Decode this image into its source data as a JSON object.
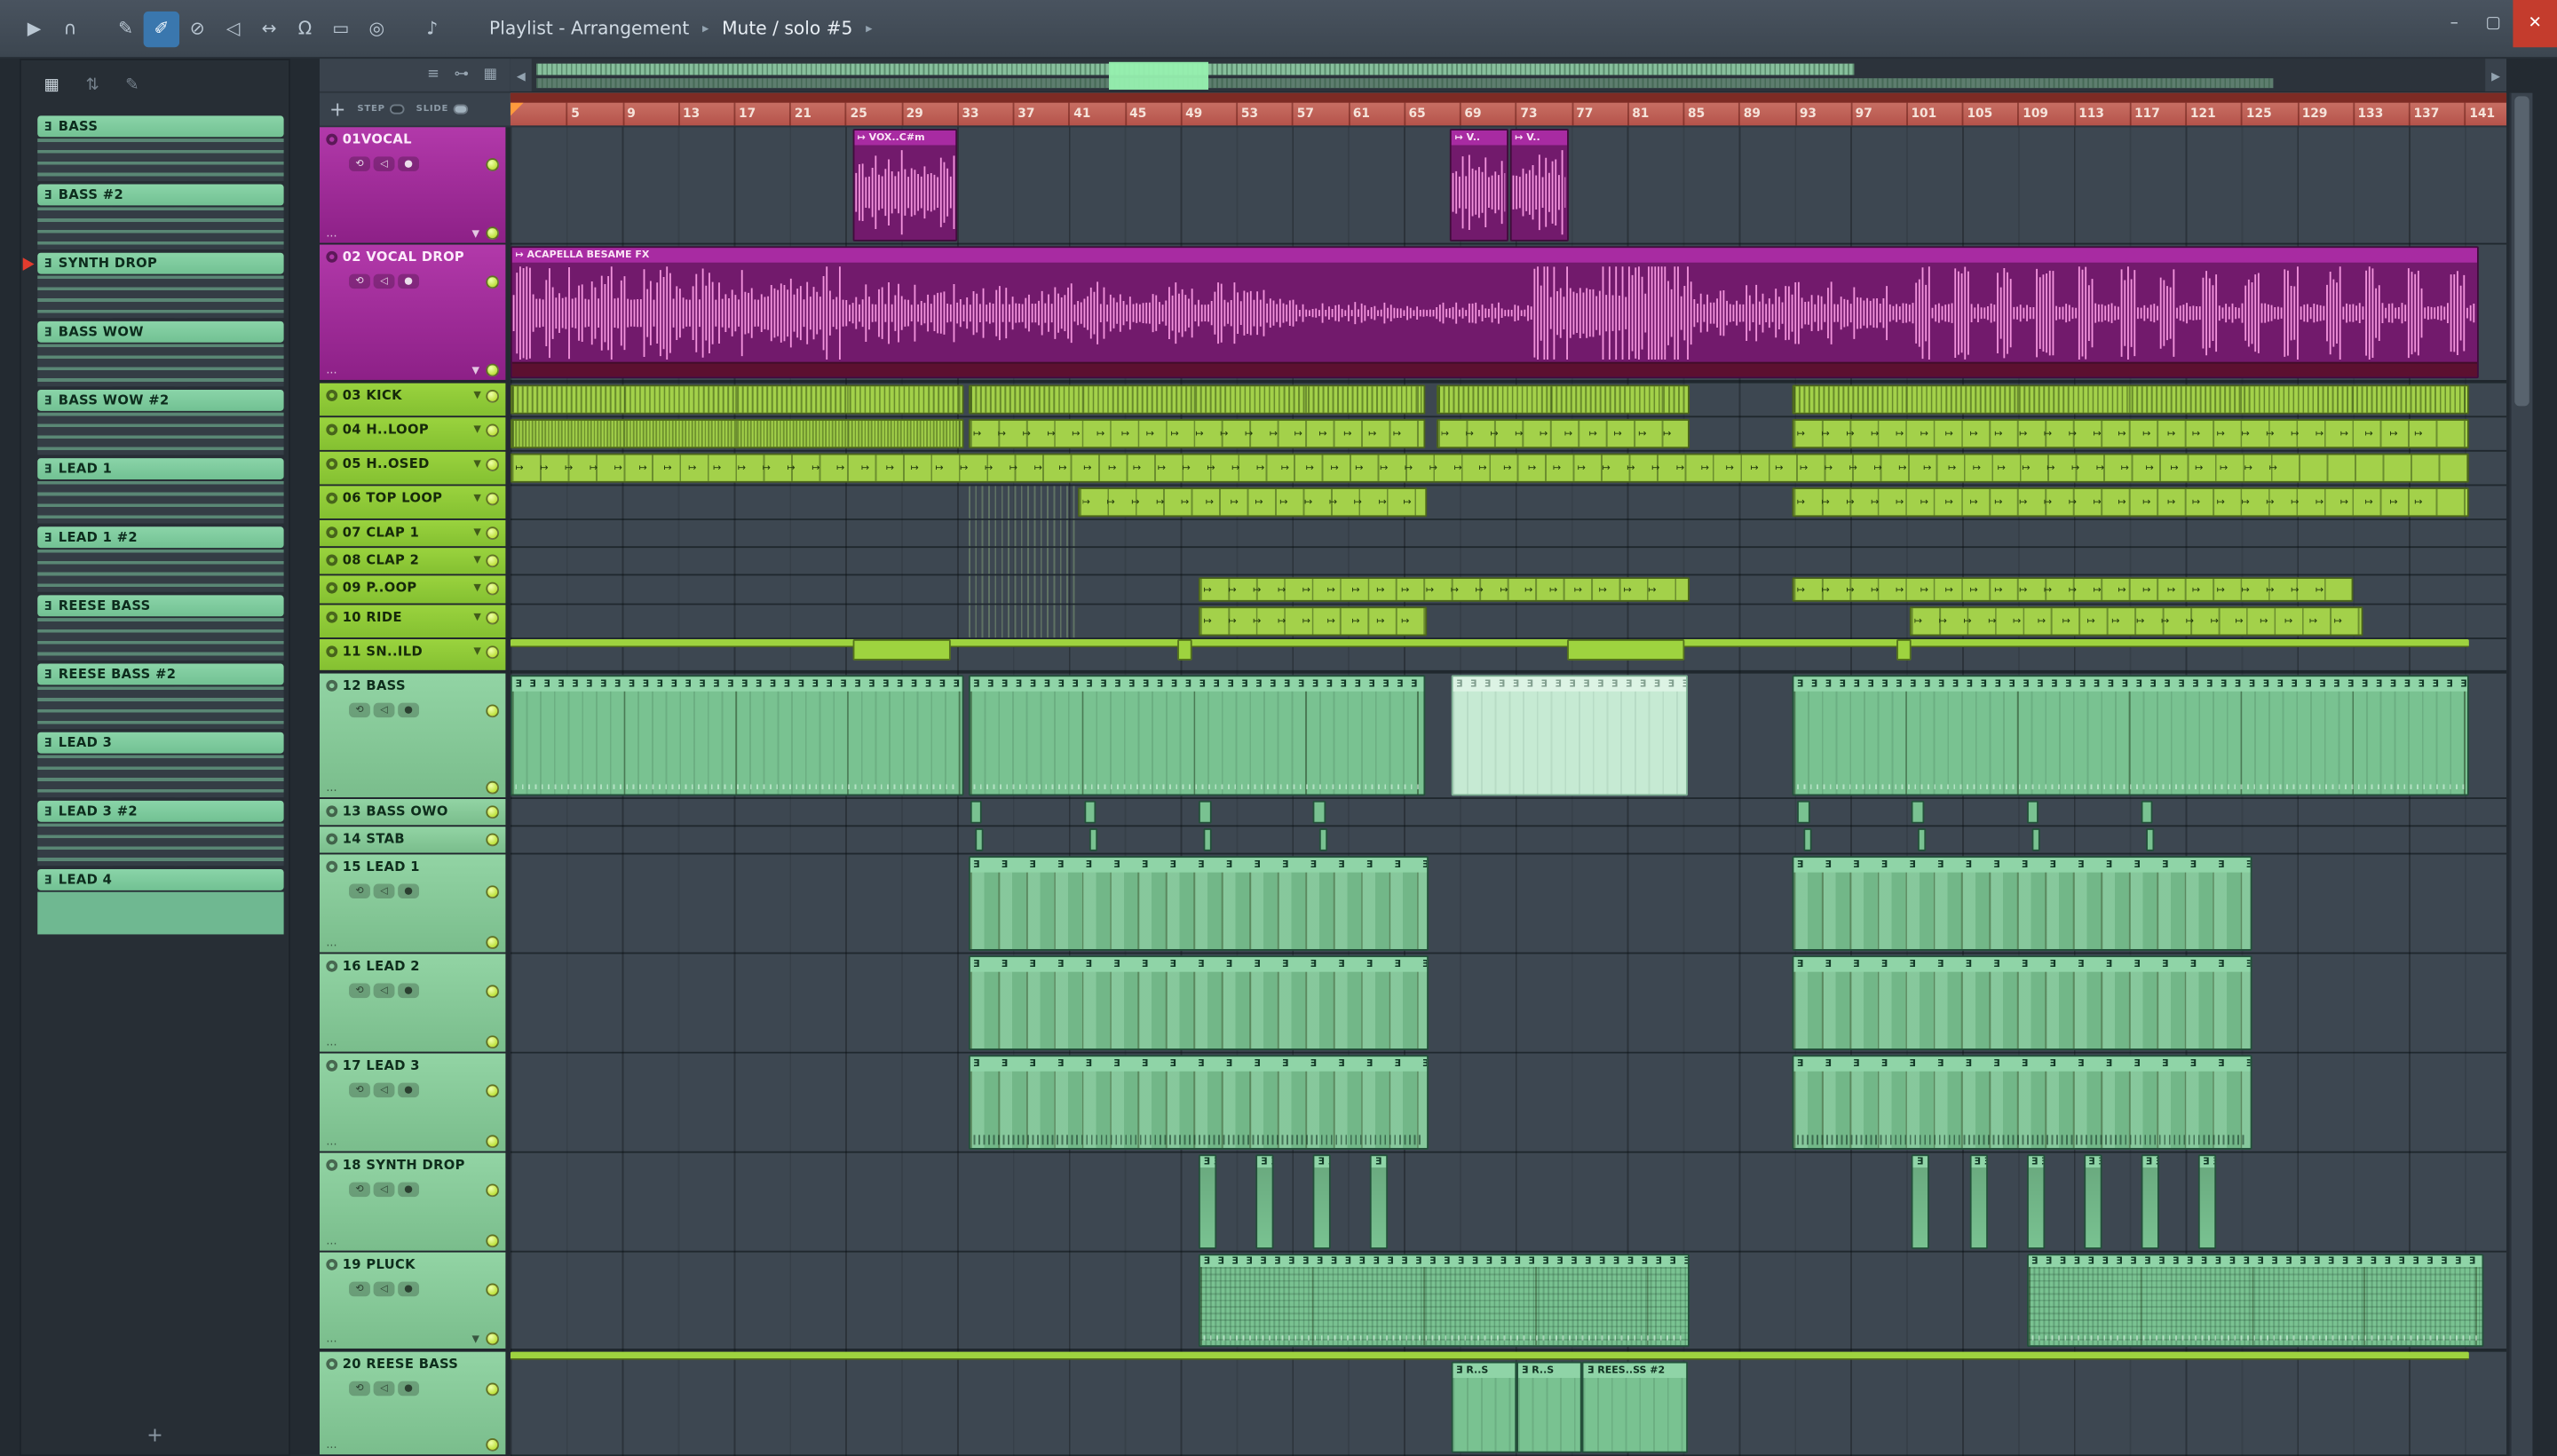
{
  "titlebar": {
    "title": "Playlist - Arrangement",
    "subtitle": "Mute / solo #5",
    "separator": "▸",
    "icons": [
      {
        "name": "play-icon",
        "glyph": "▶"
      },
      {
        "name": "headphones-icon",
        "glyph": "∩"
      },
      {
        "name": "slip-edit-tool-icon",
        "glyph": "✎"
      },
      {
        "name": "paint-tool-icon",
        "glyph": "✐",
        "active": true
      },
      {
        "name": "delete-tool-icon",
        "glyph": "⊘"
      },
      {
        "name": "mute-tool-icon",
        "glyph": "◁"
      },
      {
        "name": "slide-tool-icon",
        "glyph": "↔"
      },
      {
        "name": "snap-magnet-icon",
        "glyph": "Ω"
      },
      {
        "name": "select-tool-icon",
        "glyph": "▭"
      },
      {
        "name": "zoom-tool-icon",
        "glyph": "◎"
      },
      {
        "name": "preview-speaker-icon",
        "glyph": "♪"
      }
    ],
    "window_buttons": {
      "minimize": "–",
      "maximize": "▢",
      "close": "✕"
    }
  },
  "glyphs": {
    "note": "Ǝ",
    "loop_arrow": "↦",
    "down": "▼",
    "dots": "...",
    "left_arrow": "◀",
    "right_arrow": "▶",
    "track_controls": [
      "⟲",
      "◁",
      "●"
    ]
  },
  "picker": {
    "toolbar_icons": [
      {
        "name": "picker-view-icon",
        "glyph": "▦",
        "on": true
      },
      {
        "name": "picker-sort-icon",
        "glyph": "⇅"
      },
      {
        "name": "picker-edit-icon",
        "glyph": "✎"
      }
    ],
    "items": [
      {
        "label": "BASS"
      },
      {
        "label": "BASS #2"
      },
      {
        "label": "SYNTH DROP",
        "playing": true
      },
      {
        "label": "BASS WOW"
      },
      {
        "label": "BASS WOW #2"
      },
      {
        "label": "LEAD 1"
      },
      {
        "label": "LEAD 1 #2"
      },
      {
        "label": "REESE BASS"
      },
      {
        "label": "REESE BASS #2"
      },
      {
        "label": "LEAD 3"
      },
      {
        "label": "LEAD 3 #2"
      },
      {
        "label": "LEAD 4",
        "solid": true
      }
    ],
    "add_label": "+"
  },
  "playlist": {
    "corner": {
      "add_label": "+",
      "step_label": "STEP",
      "slide_label": "SLIDE",
      "tools": [
        {
          "name": "performance-mode-icon",
          "glyph": "≡"
        },
        {
          "name": "link-icon",
          "glyph": "⊶"
        },
        {
          "name": "grid-color-icon",
          "glyph": "▦"
        }
      ]
    },
    "bars_visible": 143,
    "ruler_numbers": [
      5,
      9,
      13,
      17,
      21,
      25,
      29,
      33,
      37,
      41,
      45,
      49,
      53,
      57,
      61,
      65,
      69,
      73,
      77,
      81,
      85,
      89,
      93,
      97,
      101,
      105,
      109,
      113,
      117,
      121,
      125,
      129,
      133,
      137,
      141
    ],
    "tracks": [
      {
        "num": "01",
        "label": "01VOCAL",
        "color": "purple",
        "h": 72,
        "tall": true,
        "collapse": true
      },
      {
        "num": "02",
        "label": "02 VOCAL DROP",
        "color": "purple",
        "h": 85,
        "tall": true,
        "collapse": true,
        "hsep": true
      },
      {
        "num": "03",
        "label": "03 KICK",
        "color": "green",
        "h": 21,
        "dd": true
      },
      {
        "num": "04",
        "label": "04 H..LOOP",
        "color": "green",
        "h": 21,
        "dd": true
      },
      {
        "num": "05",
        "label": "05 H..OSED",
        "color": "green",
        "h": 21,
        "dd": true
      },
      {
        "num": "06",
        "label": "06 TOP LOOP",
        "color": "green",
        "h": 21,
        "dd": true
      },
      {
        "num": "07",
        "label": "07 CLAP 1",
        "color": "green",
        "h": 17,
        "dd": true
      },
      {
        "num": "08",
        "label": "08 CLAP 2",
        "color": "green",
        "h": 17,
        "dd": true
      },
      {
        "num": "09",
        "label": "09 P..OOP",
        "color": "green",
        "h": 18,
        "dd": true
      },
      {
        "num": "10",
        "label": "10 RIDE",
        "color": "green",
        "h": 21,
        "dd": true
      },
      {
        "num": "11",
        "label": "11 SN..ILD",
        "color": "green",
        "h": 21,
        "dd": true,
        "hsep": true
      },
      {
        "num": "12",
        "label": "12 BASS",
        "color": "teal",
        "h": 77,
        "tall": true
      },
      {
        "num": "13",
        "label": "13 BASS OWO",
        "color": "teal",
        "h": 17
      },
      {
        "num": "14",
        "label": "14 STAB",
        "color": "teal",
        "h": 17
      },
      {
        "num": "15",
        "label": "15 LEAD 1",
        "color": "teal",
        "h": 61,
        "tall": true
      },
      {
        "num": "16",
        "label": "16 LEAD 2",
        "color": "teal",
        "h": 61,
        "tall": true
      },
      {
        "num": "17",
        "label": "17 LEAD 3",
        "color": "teal",
        "h": 61,
        "tall": true
      },
      {
        "num": "18",
        "label": "18 SYNTH DROP",
        "color": "teal",
        "h": 61,
        "tall": true
      },
      {
        "num": "19",
        "label": "19 PLUCK",
        "color": "teal",
        "h": 61,
        "tall": true,
        "collapse": true,
        "hsep": true
      },
      {
        "num": "20",
        "label": "20 REESE BASS",
        "color": "teal",
        "h": 64,
        "tall": true
      }
    ],
    "clips": [
      {
        "t": 1,
        "s": 25.5,
        "l": 7.5,
        "k": "audio",
        "label": "↦ VOX..C#m"
      },
      {
        "t": 1,
        "s": 68.3,
        "l": 4.2,
        "k": "audio",
        "label": "↦ V.."
      },
      {
        "t": 1,
        "s": 72.6,
        "l": 4.2,
        "k": "audio",
        "label": "↦ V.."
      },
      {
        "t": 2,
        "s": 1,
        "l": 141,
        "k": "audio-long",
        "label": "↦ ACAPELLA BESAME FX"
      },
      {
        "t": 3,
        "s": 1,
        "l": 32.5,
        "k": "kick"
      },
      {
        "t": 3,
        "s": 33.8,
        "l": 32.8,
        "k": "kick"
      },
      {
        "t": 3,
        "s": 67.3,
        "l": 18.2,
        "k": "kick"
      },
      {
        "t": 3,
        "s": 92.8,
        "l": 48.5,
        "k": "kick"
      },
      {
        "t": 4,
        "s": 1,
        "l": 32.5,
        "k": "dense"
      },
      {
        "t": 4,
        "s": 33.8,
        "l": 32.8,
        "k": "arrows"
      },
      {
        "t": 4,
        "s": 67.3,
        "l": 18.2,
        "k": "arrows"
      },
      {
        "t": 4,
        "s": 92.8,
        "l": 48.5,
        "k": "arrows"
      },
      {
        "t": 5,
        "s": 1,
        "l": 140.3,
        "k": "arrows"
      },
      {
        "t": 6,
        "s": 33.8,
        "l": 7.7,
        "k": "striped"
      },
      {
        "t": 6,
        "s": 41.6,
        "l": 25,
        "k": "arrows"
      },
      {
        "t": 6,
        "s": 92.8,
        "l": 48.5,
        "k": "arrows"
      },
      {
        "t": 7,
        "s": 33.8,
        "l": 7.7,
        "k": "striped"
      },
      {
        "t": 8,
        "s": 33.8,
        "l": 7.7,
        "k": "striped"
      },
      {
        "t": 9,
        "s": 33.8,
        "l": 7.7,
        "k": "striped"
      },
      {
        "t": 9,
        "s": 50.3,
        "l": 35.2,
        "k": "arrows"
      },
      {
        "t": 9,
        "s": 92.8,
        "l": 40.2,
        "k": "arrows"
      },
      {
        "t": 10,
        "s": 33.8,
        "l": 7.7,
        "k": "striped"
      },
      {
        "t": 10,
        "s": 50.3,
        "l": 16.4,
        "k": "arrows"
      },
      {
        "t": 10,
        "s": 101.2,
        "l": 32.5,
        "k": "arrows"
      },
      {
        "t": 11,
        "s": 1,
        "l": 140.3,
        "k": "thin"
      },
      {
        "t": 11,
        "s": 25.5,
        "l": 7,
        "k": "block"
      },
      {
        "t": 11,
        "s": 48.8,
        "l": 1,
        "k": "block"
      },
      {
        "t": 11,
        "s": 76.7,
        "l": 8.4,
        "k": "block"
      },
      {
        "t": 11,
        "s": 100.3,
        "l": 1,
        "k": "block"
      },
      {
        "t": 12,
        "s": 1,
        "l": 32.5,
        "k": "bass"
      },
      {
        "t": 12,
        "s": 33.8,
        "l": 32.8,
        "k": "bass"
      },
      {
        "t": 12,
        "s": 68.4,
        "l": 17,
        "k": "bass-ghost"
      },
      {
        "t": 12,
        "s": 92.8,
        "l": 48.5,
        "k": "bass"
      },
      {
        "t": 13,
        "s": 33.9,
        "l": 0.9,
        "k": "small"
      },
      {
        "t": 13,
        "s": 42.1,
        "l": 0.9,
        "k": "small"
      },
      {
        "t": 13,
        "s": 50.3,
        "l": 0.9,
        "k": "small"
      },
      {
        "t": 13,
        "s": 58.5,
        "l": 0.9,
        "k": "small"
      },
      {
        "t": 13,
        "s": 93.2,
        "l": 0.9,
        "k": "small"
      },
      {
        "t": 13,
        "s": 101.4,
        "l": 0.9,
        "k": "small"
      },
      {
        "t": 13,
        "s": 109.6,
        "l": 0.9,
        "k": "small"
      },
      {
        "t": 13,
        "s": 117.8,
        "l": 0.9,
        "k": "small"
      },
      {
        "t": 14,
        "s": 34.3,
        "l": 0.6,
        "k": "small"
      },
      {
        "t": 14,
        "s": 42.5,
        "l": 0.6,
        "k": "small"
      },
      {
        "t": 14,
        "s": 50.7,
        "l": 0.6,
        "k": "small"
      },
      {
        "t": 14,
        "s": 58.9,
        "l": 0.6,
        "k": "small"
      },
      {
        "t": 14,
        "s": 93.6,
        "l": 0.6,
        "k": "small"
      },
      {
        "t": 14,
        "s": 101.8,
        "l": 0.6,
        "k": "small"
      },
      {
        "t": 14,
        "s": 110.0,
        "l": 0.6,
        "k": "small"
      },
      {
        "t": 14,
        "s": 118.2,
        "l": 0.6,
        "k": "small"
      },
      {
        "t": 15,
        "s": 33.8,
        "l": 33,
        "k": "lead"
      },
      {
        "t": 15,
        "s": 92.8,
        "l": 33,
        "k": "lead"
      },
      {
        "t": 16,
        "s": 33.8,
        "l": 33,
        "k": "lead"
      },
      {
        "t": 16,
        "s": 92.8,
        "l": 33,
        "k": "lead"
      },
      {
        "t": 17,
        "s": 33.8,
        "l": 33,
        "k": "lead3"
      },
      {
        "t": 17,
        "s": 92.8,
        "l": 33,
        "k": "lead3"
      },
      {
        "t": 18,
        "s": 50.3,
        "l": 1.3,
        "k": "drop"
      },
      {
        "t": 18,
        "s": 54.4,
        "l": 1.3,
        "k": "drop"
      },
      {
        "t": 18,
        "s": 58.5,
        "l": 1.3,
        "k": "drop"
      },
      {
        "t": 18,
        "s": 62.6,
        "l": 1.3,
        "k": "drop"
      },
      {
        "t": 18,
        "s": 101.4,
        "l": 1.3,
        "k": "drop"
      },
      {
        "t": 18,
        "s": 105.5,
        "l": 1.3,
        "k": "drop"
      },
      {
        "t": 18,
        "s": 109.6,
        "l": 1.3,
        "k": "drop"
      },
      {
        "t": 18,
        "s": 113.7,
        "l": 1.3,
        "k": "drop"
      },
      {
        "t": 18,
        "s": 117.8,
        "l": 1.3,
        "k": "drop"
      },
      {
        "t": 18,
        "s": 121.9,
        "l": 1.3,
        "k": "drop"
      },
      {
        "t": 19,
        "s": 50.3,
        "l": 35.2,
        "k": "pluck"
      },
      {
        "t": 19,
        "s": 109.6,
        "l": 32.8,
        "k": "pluck"
      },
      {
        "t": 20,
        "s": 1,
        "l": 140.3,
        "k": "thin"
      },
      {
        "t": 20,
        "s": 68.4,
        "l": 4.7,
        "k": "reese",
        "label": "Ǝ R..S"
      },
      {
        "t": 20,
        "s": 73.1,
        "l": 4.7,
        "k": "reese",
        "label": "Ǝ R..S"
      },
      {
        "t": 20,
        "s": 77.8,
        "l": 7.6,
        "k": "reese",
        "label": "Ǝ REES..SS #2"
      }
    ]
  },
  "colors": {
    "accent_green": "#9ccd3f",
    "accent_teal": "#7cc393",
    "accent_purple": "#a32ba0",
    "ruler_red": "#c4625a",
    "waveform_pink": "#f293dc",
    "led_green": "#c9e84b"
  }
}
